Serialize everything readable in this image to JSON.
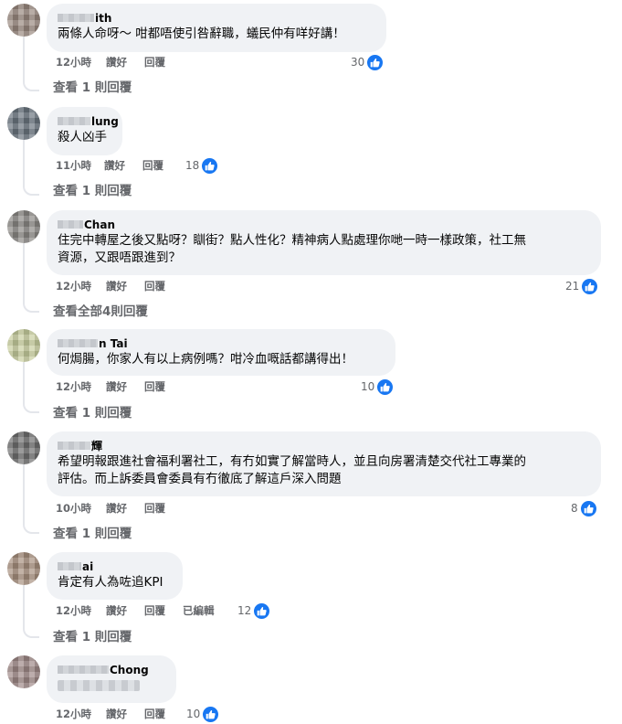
{
  "icons": {
    "like": "thumbs-up-icon"
  },
  "colors": {
    "like_blue": "#1877f2",
    "bubble": "#f0f2f5",
    "meta_text": "#65676b"
  },
  "comments": [
    {
      "name": "ith",
      "text": "兩條人命呀～ 咁都唔使引咎辭職，蟻民仲有咩好講！",
      "time": "12小時",
      "like": "讚好",
      "reply": "回覆",
      "likes": "30",
      "view_replies": "查看 1 則回覆"
    },
    {
      "name": "lung",
      "text": "殺人凶手",
      "time": "11小時",
      "like": "讚好",
      "reply": "回覆",
      "likes": "18",
      "view_replies": "查看 1 則回覆"
    },
    {
      "name": "Chan",
      "text_line1": "住完中轉屋之後又點呀？瞓街？點人性化？精神病人點處理你哋一時一樣政策，社工無",
      "text_line2": "資源，又跟唔跟進到？",
      "time": "12小時",
      "like": "讚好",
      "reply": "回覆",
      "likes": "21",
      "view_replies": "查看全部4則回覆"
    },
    {
      "name": "n Tai",
      "text": "何焗腸，你家人有以上病例嗎？咁冷血嘅話都講得出！",
      "time": "12小時",
      "like": "讚好",
      "reply": "回覆",
      "likes": "10",
      "view_replies": "查看 1 則回覆"
    },
    {
      "name": "輝",
      "text_line1": "希望明報跟進社會福利署社工，有冇如實了解當時人，並且向房署清楚交代社工專業的",
      "text_line2": "評估。而上訴委員會委員有冇徹底了解這戶深入問題",
      "time": "10小時",
      "like": "讚好",
      "reply": "回覆",
      "likes": "8",
      "view_replies": "查看 1 則回覆"
    },
    {
      "name": "ai",
      "text": "肯定有人為咗追KPI",
      "time": "12小時",
      "like": "讚好",
      "reply": "回覆",
      "edited": "已編輯",
      "likes": "12",
      "view_replies": "查看 1 則回覆"
    },
    {
      "name": "Chong",
      "time": "12小時",
      "like": "讚好",
      "reply": "回覆",
      "likes": "10"
    }
  ]
}
